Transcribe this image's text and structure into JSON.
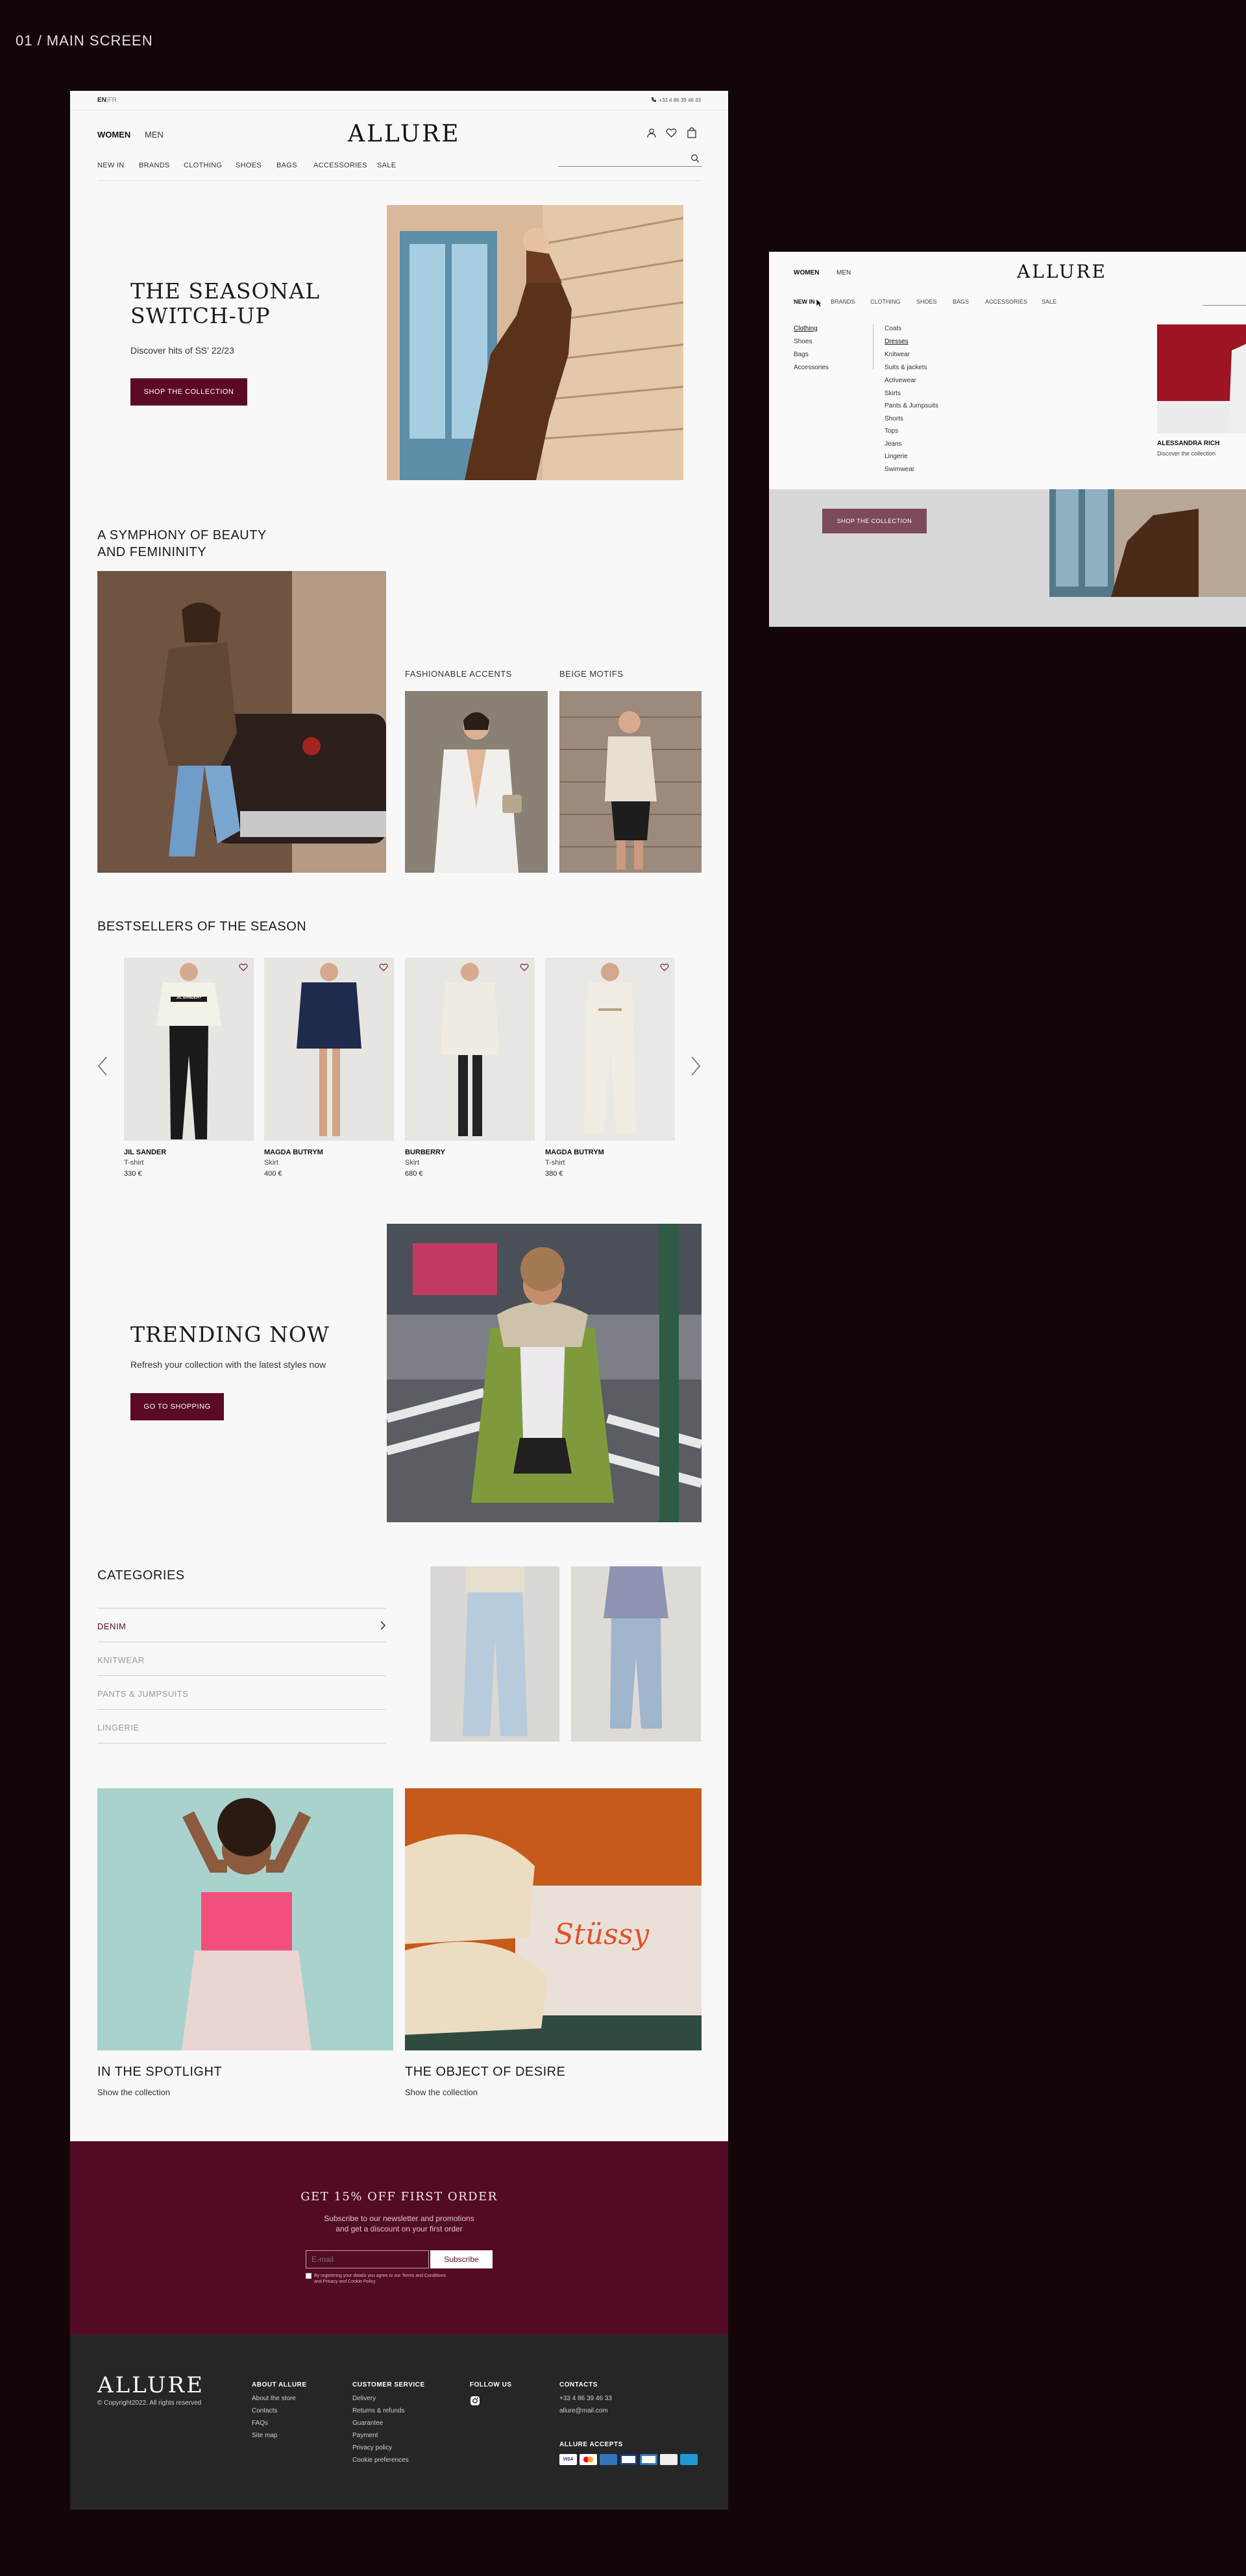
{
  "screen_label": "01 / MAIN SCREEN",
  "colors": {
    "brand": "#5a0a25",
    "background": "#140608",
    "page": "#f8f8f8",
    "footer": "#262626"
  },
  "topbar": {
    "lang_en": "EN",
    "lang_sep": "|",
    "lang_fr": "FR",
    "phone": "+33 4 86 39 46 33"
  },
  "header": {
    "women": "WOMEN",
    "men": "MEN",
    "logo": "ALLURE",
    "icons": [
      "user-icon",
      "heart-icon",
      "bag-icon",
      "search-icon"
    ],
    "search_placeholder": ""
  },
  "nav": [
    "NEW IN",
    "BRANDS",
    "CLOTHING",
    "SHOES",
    "BAGS",
    "ACCESSORIES",
    "SALE"
  ],
  "hero": {
    "title_line1": "THE SEASONAL",
    "title_line2": "SWITCH-UP",
    "subtitle": "Discover hits of SS' 22/23",
    "button": "SHOP THE COLLECTION"
  },
  "symphony": {
    "title_line1": "A SYMPHONY OF BEAUTY",
    "title_line2": "AND FEMININITY",
    "caption1": "FASHIONABLE ACCENTS",
    "caption2": "BEIGE MOTIFS"
  },
  "bestsellers": {
    "title": "BESTSELLERS OF THE SEASON",
    "products": [
      {
        "brand": "JIL SANDER",
        "type": "T-shirt",
        "price": "330 €"
      },
      {
        "brand": "MAGDA BUTRYM",
        "type": "Skirt",
        "price": "400 €"
      },
      {
        "brand": "BURBERRY",
        "type": "Skirt",
        "price": "680 €"
      },
      {
        "brand": "MAGDA BUTRYM",
        "type": "T-shirt",
        "price": "380 €"
      }
    ],
    "tshirt_print": "JIL SANDER+"
  },
  "trending": {
    "title": "TRENDING NOW",
    "subtitle": "Refresh your collection with the latest styles now",
    "button": "GO TO SHOPPING"
  },
  "categories": {
    "title": "CATEGORIES",
    "items": [
      "DENIM",
      "KNITWEAR",
      "PANTS & JUMPSUITS",
      "LINGERIE"
    ]
  },
  "promos": [
    {
      "title": "IN THE SPOTLIGHT",
      "link": "Show the collection"
    },
    {
      "title": "THE OBJECT OF DESIRE",
      "link": "Show the collection"
    }
  ],
  "newsletter": {
    "title": "GET 15% OFF FIRST ORDER",
    "text_line1": "Subscribe to our newsletter and promotions",
    "text_line2": "and get a discount on your first order",
    "email_placeholder": "E-mail",
    "button": "Subscribe",
    "consent_line1": "By registering your details you agree to our Terms and Conditions",
    "consent_line2": "and Privacy and Cookie Policy"
  },
  "footer": {
    "logo": "ALLURE",
    "copyright": "© Copyright2022. All rights reserved",
    "about_title": "ABOUT ALLURE",
    "about_links": [
      "About the store",
      "Contacts",
      "FAQs",
      "Site map"
    ],
    "service_title": "CUSTOMER SERVICE",
    "service_links": [
      "Delivery",
      "Returns & refunds",
      "Guarantee",
      "Payment",
      "Privacy policy",
      "Cookie preferences"
    ],
    "follow_title": "FOLLOW US",
    "contacts_title": "CONTACTS",
    "phone": "+33 4 86 39 46 33",
    "email": "allure@mail.com",
    "accepts_title": "ALLURE ACCEPTS",
    "payment_icons": [
      "visa-icon",
      "mastercard-icon",
      "amex-icon",
      "card-icon",
      "card-icon",
      "card-icon",
      "paypal-icon"
    ]
  },
  "dropdown": {
    "women": "WOMEN",
    "men": "MEN",
    "logo": "ALLURE",
    "nav": [
      "NEW IN",
      "BRANDS",
      "CLOTHING",
      "SHOES",
      "BAGS",
      "ACCESSORIES",
      "SALE"
    ],
    "left_menu": [
      "Clothing",
      "Shoes",
      "Bags",
      "Accessories"
    ],
    "right_menu": [
      "Coats",
      "Dresses",
      "Knitwear",
      "Suits & jackets",
      "Activewear",
      "Skirts",
      "Pants & Jumpsuits",
      "Shorts",
      "Tops",
      "Jeans",
      "Lingerie",
      "Swimwear"
    ],
    "brand_title": "ALESSANDRA RICH",
    "brand_link": "Discover the collection",
    "button": "SHOP THE COLLECTION"
  }
}
